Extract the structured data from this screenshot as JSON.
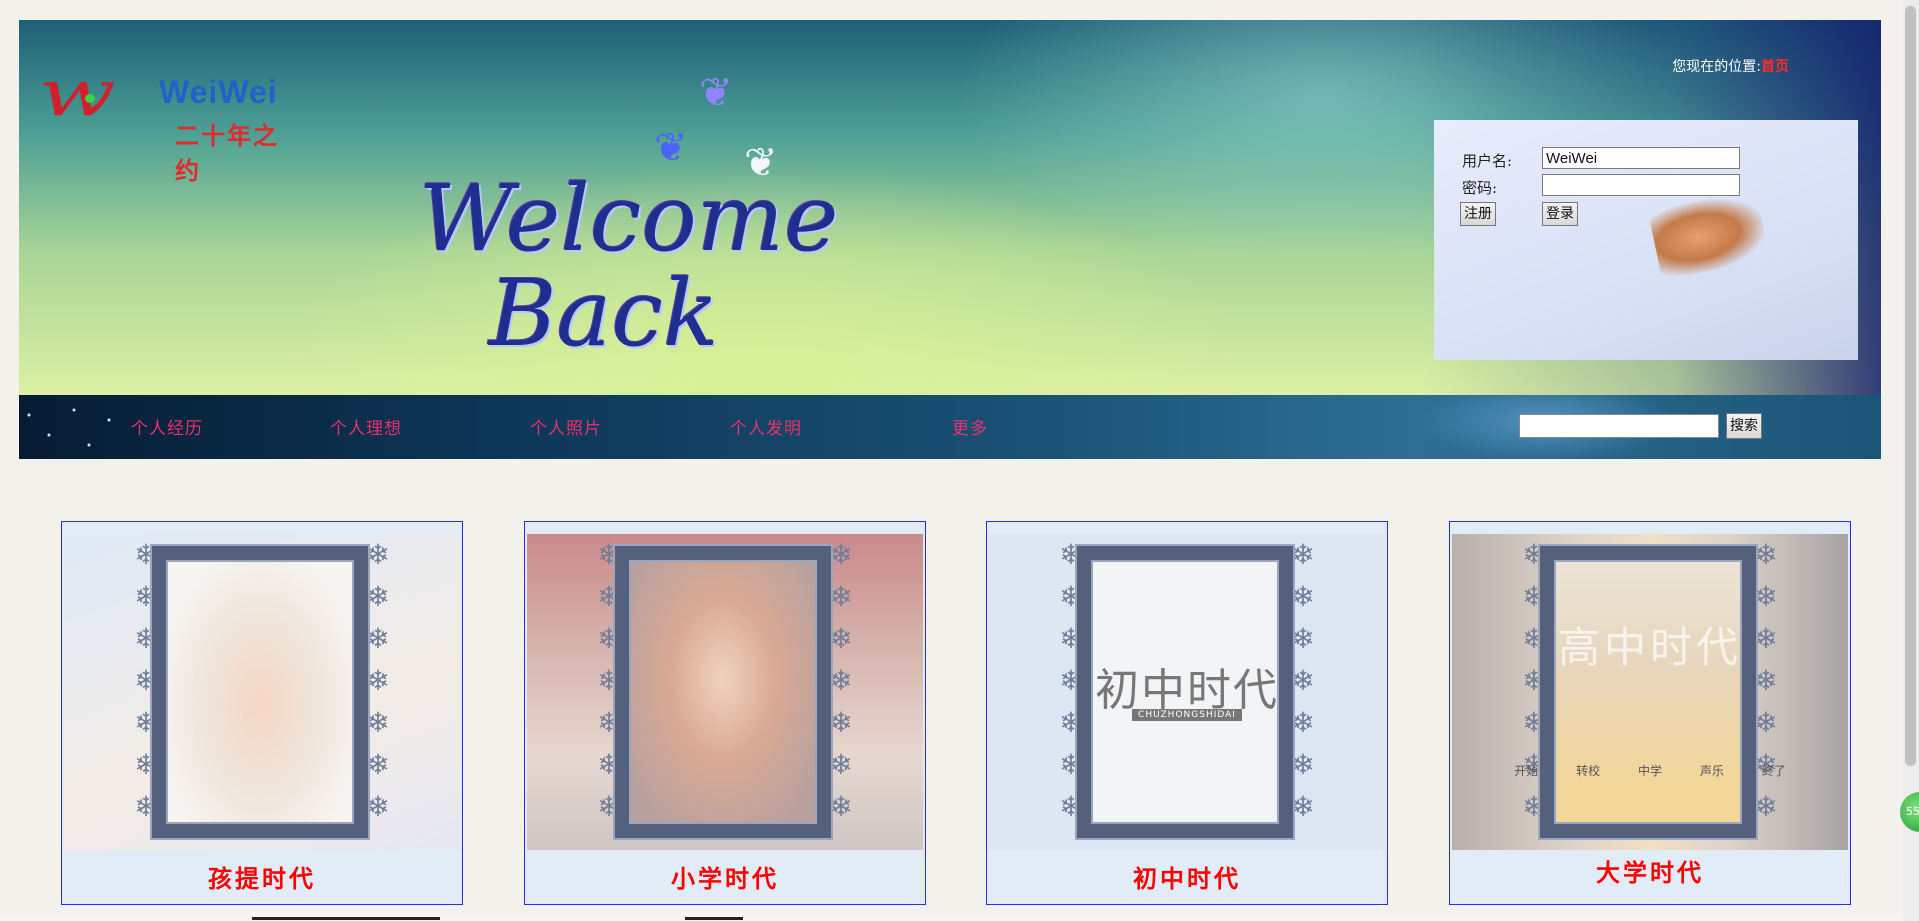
{
  "header": {
    "logo": {
      "brand": "WeiWei",
      "subtitle": "二十年之约"
    },
    "welcome": {
      "line1": "Welcome",
      "line2": "Back"
    },
    "location": {
      "prefix": "您现在的位置:",
      "current": "首页"
    }
  },
  "login": {
    "username_label": "用户名:",
    "username_value": "WeiWei",
    "password_label": "密码:",
    "register_label": "注册",
    "login_label": "登录"
  },
  "nav": {
    "items": [
      {
        "label": "个人经历"
      },
      {
        "label": "个人理想"
      },
      {
        "label": "个人照片"
      },
      {
        "label": "个人发明"
      },
      {
        "label": "更多"
      }
    ],
    "search_value": "",
    "search_button": "搜索"
  },
  "cards": [
    {
      "caption": "孩提时代",
      "photo_text": ""
    },
    {
      "caption": "小学时代",
      "photo_text": ""
    },
    {
      "caption": "初中时代",
      "photo_text": "初中时代",
      "photo_subtext": "CHUZHONGSHIDAI"
    },
    {
      "caption": "大学时代",
      "photo_text": "高中时代",
      "photo_labels": [
        "开始",
        "转校",
        "中学",
        "声乐",
        "终了"
      ]
    }
  ],
  "overlay": {
    "badge_text": "55"
  },
  "colors": {
    "nav_text": "#e8306a",
    "caption": "#ff0000",
    "card_border": "#2a2ae0",
    "location_link": "#ff2a2a"
  }
}
